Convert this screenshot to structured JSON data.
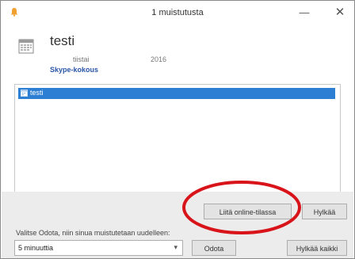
{
  "window": {
    "title": "1 muistutusta",
    "minimize_glyph": "—",
    "close_glyph": "✕"
  },
  "reminder": {
    "subject": "testi",
    "when": "tiistai",
    "year": "2016",
    "location": "Skype-kokous"
  },
  "list": {
    "items": [
      {
        "label": "testi",
        "selected": true
      }
    ]
  },
  "buttons": {
    "join_online_label": "Liitä online-tilassa",
    "dismiss_label": "Hylkää",
    "snooze_label": "Odota",
    "dismiss_all_label": "Hylkää kaikki"
  },
  "snooze": {
    "hint": "Valitse Odota, niin sinua muistutetaan uudelleen:",
    "selected": "5 minuuttia",
    "arrow": "▾"
  },
  "colors": {
    "selection": "#2d7fd3",
    "link": "#2a56a6",
    "annotation_circle": "#d8141a"
  },
  "icons": [
    "bell-icon",
    "calendar-icon",
    "appointment-icon",
    "chevron-down-icon"
  ]
}
